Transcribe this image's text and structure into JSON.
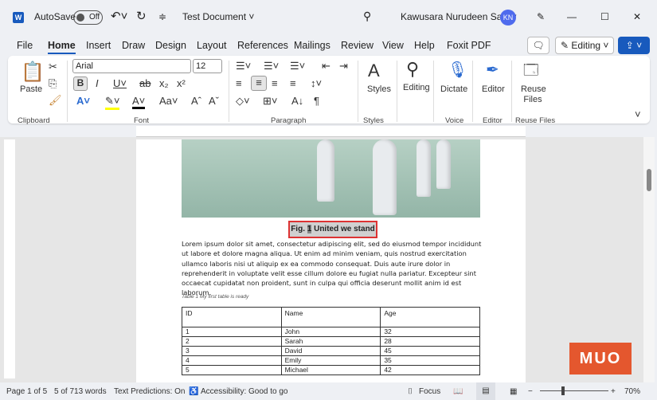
{
  "titlebar": {
    "autosave": "AutoSave",
    "toggle": "Off",
    "doc_title": "Test Document",
    "user": "Kawusara Nurudeen Salley",
    "initials": "KN"
  },
  "tabs": [
    "File",
    "Home",
    "Insert",
    "Draw",
    "Design",
    "Layout",
    "References",
    "Mailings",
    "Review",
    "View",
    "Help",
    "Foxit PDF"
  ],
  "editing_btn": "Editing",
  "ribbon": {
    "paste": "Paste",
    "font": "Arial",
    "size": "12",
    "groups": {
      "clipboard": "Clipboard",
      "font": "Font",
      "paragraph": "Paragraph",
      "styles": "Styles",
      "voice": "Voice",
      "editor": "Editor",
      "reuse": "Reuse Files"
    },
    "styles": "Styles",
    "editing": "Editing",
    "dictate": "Dictate",
    "editor": "Editor",
    "reuse": "Reuse Files"
  },
  "document": {
    "caption_prefix": "Fig. ",
    "caption_num": "1",
    "caption_text": " United we stand",
    "paragraph": "Lorem ipsum dolor sit amet, consectetur adipiscing elit, sed do eiusmod tempor incididunt ut labore et dolore magna aliqua. Ut enim ad minim veniam, quis nostrud exercitation ullamco laboris nisi ut aliquip ex ea commodo consequat. Duis aute irure dolor in reprehenderit in voluptate velit esse cillum dolore eu fugiat nulla pariatur. Excepteur sint occaecat cupidatat non proident, sunt in culpa qui officia deserunt mollit anim id est laborum.",
    "table_caption": "Table 1 My first table is ready",
    "table": {
      "headers": [
        "ID",
        "Name",
        "Age"
      ],
      "rows": [
        [
          "1",
          "John",
          "32"
        ],
        [
          "2",
          "Sarah",
          "28"
        ],
        [
          "3",
          "David",
          "45"
        ],
        [
          "4",
          "Emily",
          "35"
        ],
        [
          "5",
          "Michael",
          "42"
        ]
      ]
    }
  },
  "status": {
    "page": "Page 1 of 5",
    "words": "5 of 713 words",
    "predictions": "Text Predictions: On",
    "accessibility": "Accessibility: Good to go",
    "focus": "Focus",
    "zoom": "70%"
  },
  "watermark": "MUO"
}
